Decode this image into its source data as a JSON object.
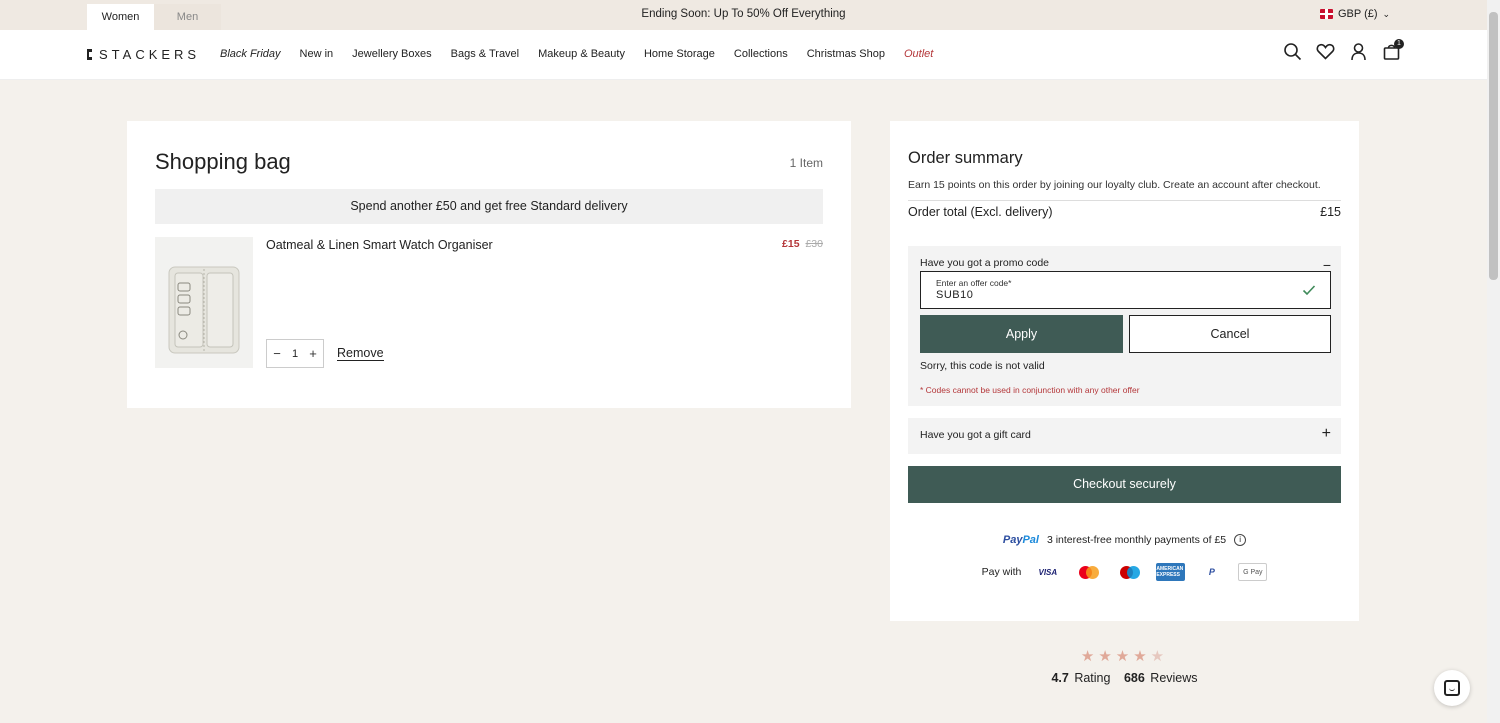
{
  "topbar": {
    "tabs": [
      {
        "label": "Women",
        "active": true
      },
      {
        "label": "Men",
        "active": false
      }
    ],
    "promo": "Ending Soon: Up To 50% Off Everything",
    "currency": "GBP (£)"
  },
  "nav": {
    "logo": "STACKERS",
    "links": [
      "Black Friday",
      "New in",
      "Jewellery Boxes",
      "Bags & Travel",
      "Makeup & Beauty",
      "Home Storage",
      "Collections",
      "Christmas Shop",
      "Outlet"
    ],
    "bag_count": "1",
    "icons": [
      "search-icon",
      "heart-icon",
      "user-icon",
      "bag-icon"
    ]
  },
  "bag": {
    "title": "Shopping bag",
    "count": "1 Item",
    "delivery_message": "Spend another £50 and get free Standard delivery",
    "item": {
      "name": "Oatmeal & Linen Smart Watch Organiser",
      "price_now": "£15",
      "price_was": "£30",
      "quantity": "1",
      "remove_label": "Remove"
    }
  },
  "summary": {
    "title": "Order summary",
    "loyalty": "Earn 15 points on this order by joining our loyalty club. Create an account after checkout.",
    "total_label": "Order total (Excl. delivery)",
    "total_value": "£15",
    "promo": {
      "label": "Have you got a promo code",
      "field_label": "Enter an offer code*",
      "field_value": "SUB10",
      "apply": "Apply",
      "cancel": "Cancel",
      "error": "Sorry, this code is not valid",
      "note": "* Codes cannot be used in conjunction with any other offer"
    },
    "gift_label": "Have you got a gift card",
    "checkout": "Checkout securely",
    "paypal": {
      "brand_a": "Pay",
      "brand_b": "Pal",
      "text": "3 interest-free monthly payments of £5"
    },
    "pay_with": "Pay with",
    "payment_methods": [
      "VISA",
      "mastercard",
      "maestro",
      "AMERICAN EXPRESS",
      "P",
      "G Pay"
    ]
  },
  "rating": {
    "stars": "★★★★",
    "half_star": "★",
    "score": "4.7",
    "score_label": "Rating",
    "reviews": "686",
    "reviews_label": "Reviews"
  },
  "colors": {
    "accent": "#3f5b55",
    "sale": "#b4373a",
    "background": "#f4f1ec"
  }
}
